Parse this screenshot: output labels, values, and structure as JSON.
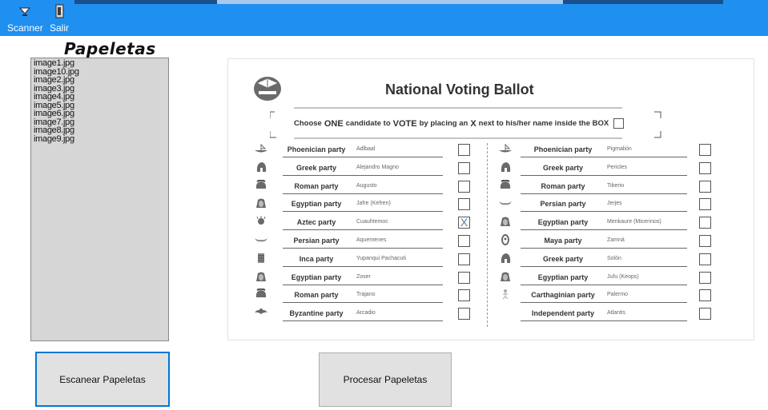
{
  "toolbar": {
    "scanner_label": "Scanner",
    "salir_label": "Salir",
    "bg_color": "#1f8ff0"
  },
  "sidebar": {
    "title": "Papeletas",
    "files": [
      "image1.jpg",
      "image10.jpg",
      "image2.jpg",
      "image3.jpg",
      "image4.jpg",
      "image5.jpg",
      "image6.jpg",
      "image7.jpg",
      "image8.jpg",
      "image9.jpg"
    ]
  },
  "buttons": {
    "scan": "Escanear Papeletas",
    "process": "Procesar Papeletas"
  },
  "ballot": {
    "title": "National Voting Ballot",
    "instruction": {
      "pre": "Choose",
      "one": "ONE",
      "mid": "candidate to",
      "vote": "VOTE",
      "mid2": "by placing an",
      "x": "X",
      "post": "next to his/her name inside the BOX"
    },
    "left": [
      {
        "party": "Phoenician party",
        "candidate": "Adlbaal",
        "icon": "ship-icon",
        "checked": false
      },
      {
        "party": "Greek party",
        "candidate": "Alejandro Magno",
        "icon": "greek-helmet-icon",
        "checked": false
      },
      {
        "party": "Roman party",
        "candidate": "Augusto",
        "icon": "roman-helmet-icon",
        "checked": false
      },
      {
        "party": "Egyptian party",
        "candidate": "Jafre (Kefren)",
        "icon": "pharaoh-icon",
        "checked": false
      },
      {
        "party": "Aztec party",
        "candidate": "Cuauhtemoc",
        "icon": "aztec-icon",
        "checked": true,
        "mark": "X"
      },
      {
        "party": "Persian party",
        "candidate": "Aquemenes",
        "icon": "winged-symbol-icon",
        "checked": false
      },
      {
        "party": "Inca party",
        "candidate": "Yupanqui Pachacuti",
        "icon": "inca-icon",
        "checked": false
      },
      {
        "party": "Egyptian party",
        "candidate": "Zoser",
        "icon": "pharaoh-icon",
        "checked": false
      },
      {
        "party": "Roman party",
        "candidate": "Trajano",
        "icon": "roman-helmet-icon",
        "checked": false
      },
      {
        "party": "Byzantine party",
        "candidate": "Arcadio",
        "icon": "eagle-icon",
        "checked": false
      }
    ],
    "right": [
      {
        "party": "Phoenician party",
        "candidate": "Pigmalión",
        "icon": "ship-icon",
        "checked": false
      },
      {
        "party": "Greek party",
        "candidate": "Pericles",
        "icon": "greek-helmet-icon",
        "checked": false
      },
      {
        "party": "Roman party",
        "candidate": "Tiberio",
        "icon": "roman-helmet-icon",
        "checked": false
      },
      {
        "party": "Persian party",
        "candidate": "Jerjes",
        "icon": "winged-symbol-icon",
        "checked": false
      },
      {
        "party": "Egyptian party",
        "candidate": "Menkaure (Micerinos)",
        "icon": "pharaoh-icon",
        "checked": false
      },
      {
        "party": "Maya party",
        "candidate": "Zamná",
        "icon": "maya-icon",
        "checked": false
      },
      {
        "party": "Greek party",
        "candidate": "Solón",
        "icon": "greek-helmet-icon",
        "checked": false
      },
      {
        "party": "Egyptian party",
        "candidate": "Jufu (Keops)",
        "icon": "pharaoh-icon",
        "checked": false
      },
      {
        "party": "Carthaginian party",
        "candidate": "Palermo",
        "icon": "figure-icon",
        "checked": false
      },
      {
        "party": "Independent party",
        "candidate": "Atlantis",
        "icon": "",
        "checked": false
      }
    ]
  }
}
